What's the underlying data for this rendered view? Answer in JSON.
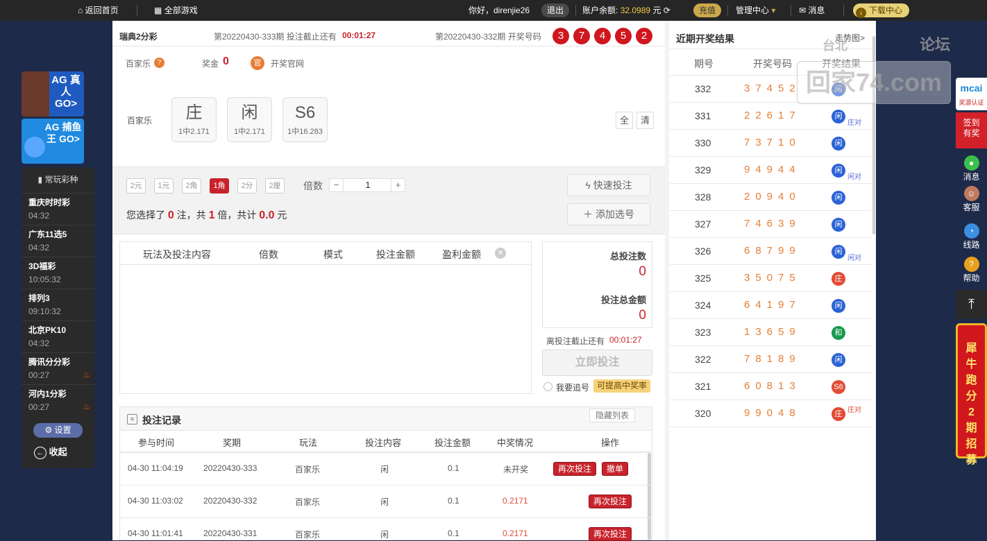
{
  "topbar": {
    "home": "返回首页",
    "all_games": "全部游戏",
    "greeting": "你好，direnjie26",
    "logout": "退出",
    "balance_label": "账户余额:",
    "balance": "32.0989",
    "unit": "元",
    "recharge": "充值",
    "manage": "管理中心",
    "msg": "消息",
    "download": "下载中心"
  },
  "header": {
    "lottery": "瑞典2分彩",
    "current_issue": "第20220430-333期 投注截止还有",
    "countdown": "00:01:27",
    "last_issue": "第20220430-332期 开奖号码",
    "balls": [
      "3",
      "7",
      "4",
      "5",
      "2"
    ]
  },
  "play": {
    "game": "百家乐",
    "prize_label": "奖金",
    "prize": "0",
    "official": "官",
    "official_label": "开奖官网",
    "row_label": "百家乐",
    "options": [
      {
        "t": "庄",
        "s": "1中2.171"
      },
      {
        "t": "闲",
        "s": "1中2.171"
      },
      {
        "t": "S6",
        "s": "1中16.283"
      }
    ],
    "all": "全",
    "clear": "清"
  },
  "units": [
    "2元",
    "1元",
    "2角",
    "1角",
    "2分",
    "2厘"
  ],
  "multiplier_label": "倍数",
  "multiplier": "1",
  "quick_bet": "快速投注",
  "add_number": "添加选号",
  "summary": {
    "p1": "您选择了",
    "notes": "0",
    "p2": "注，共",
    "times": "1",
    "p3": "倍，共计",
    "amount": "0.0",
    "p4": "元"
  },
  "cart": {
    "cols": [
      "玩法及投注内容",
      "倍数",
      "模式",
      "投注金额",
      "盈利金额"
    ]
  },
  "totals": {
    "count_label": "总投注数",
    "count": "0",
    "amount_label": "投注总金额",
    "amount": "0",
    "deadline_label": "离投注截止还有",
    "deadline": "00:01:27",
    "bet_now": "立即投注",
    "chase": "我要追号",
    "tip": "可提高中奖率"
  },
  "records": {
    "title": "投注记录",
    "hide": "隐藏列表",
    "cols": [
      "参与时间",
      "奖期",
      "玩法",
      "投注内容",
      "投注金额",
      "中奖情况",
      "操作"
    ],
    "rows": [
      {
        "time": "04-30 11:04:19",
        "issue": "20220430-333",
        "play": "百家乐",
        "content": "闲",
        "amount": "0.1",
        "status": "未开奖",
        "btn1": "再次投注",
        "btn2": "撤单"
      },
      {
        "time": "04-30 11:03:02",
        "issue": "20220430-332",
        "play": "百家乐",
        "content": "闲",
        "amount": "0.1",
        "status": "0.2171",
        "btn1": "再次投注"
      },
      {
        "time": "04-30 11:01:41",
        "issue": "20220430-331",
        "play": "百家乐",
        "content": "闲",
        "amount": "0.1",
        "status": "0.2171",
        "btn1": "再次投注"
      }
    ]
  },
  "leftnav": {
    "ag_live": "AG 真人 GO>",
    "ag_fish": "AG 捕鱼王 GO>",
    "fav_title": "常玩彩种",
    "items": [
      {
        "name": "重庆时时彩",
        "time": "04:32"
      },
      {
        "name": "广东11选5",
        "time": "04:32"
      },
      {
        "name": "3D福彩",
        "time": "10:05:32"
      },
      {
        "name": "排列3",
        "time": "09:10:32"
      },
      {
        "name": "北京PK10",
        "time": "04:32"
      },
      {
        "name": "腾讯分分彩",
        "time": "00:27"
      },
      {
        "name": "河内1分彩",
        "time": "00:27"
      }
    ],
    "settings": "设置",
    "collapse": "收起"
  },
  "results": {
    "title": "近期开奖结果",
    "trend": "走势图>",
    "cols": [
      "期号",
      "开奖号码",
      "开奖结果"
    ],
    "rows": [
      {
        "no": "332",
        "nums": "37452",
        "tag": "闲",
        "c": "b",
        "sub": ""
      },
      {
        "no": "331",
        "nums": "22617",
        "tag": "闲",
        "c": "b",
        "sub": "庄对"
      },
      {
        "no": "330",
        "nums": "73710",
        "tag": "闲",
        "c": "b",
        "sub": ""
      },
      {
        "no": "329",
        "nums": "94944",
        "tag": "闲",
        "c": "b",
        "sub": "闲对"
      },
      {
        "no": "328",
        "nums": "20940",
        "tag": "闲",
        "c": "b",
        "sub": ""
      },
      {
        "no": "327",
        "nums": "74639",
        "tag": "闲",
        "c": "b",
        "sub": ""
      },
      {
        "no": "326",
        "nums": "68799",
        "tag": "闲",
        "c": "b",
        "sub": "闲对"
      },
      {
        "no": "325",
        "nums": "35075",
        "tag": "庄",
        "c": "r",
        "sub": ""
      },
      {
        "no": "324",
        "nums": "64197",
        "tag": "闲",
        "c": "b",
        "sub": ""
      },
      {
        "no": "323",
        "nums": "13659",
        "tag": "和",
        "c": "g",
        "sub": ""
      },
      {
        "no": "322",
        "nums": "78189",
        "tag": "闲",
        "c": "b",
        "sub": ""
      },
      {
        "no": "321",
        "nums": "60813",
        "tag": "S6",
        "c": "r",
        "sub": ""
      },
      {
        "no": "320",
        "nums": "99048",
        "tag": "庄",
        "c": "r",
        "sub": "庄对"
      }
    ]
  },
  "watermark": {
    "a": "论坛",
    "b": "回家74.com",
    "c": "台北"
  },
  "sidebar": {
    "brand": "mcai",
    "cert": "奖源认证",
    "sign": "签到有奖",
    "msg": "消息",
    "service": "客服",
    "route": "线路",
    "help": "帮助",
    "banner": "犀牛跑分2期招募"
  }
}
